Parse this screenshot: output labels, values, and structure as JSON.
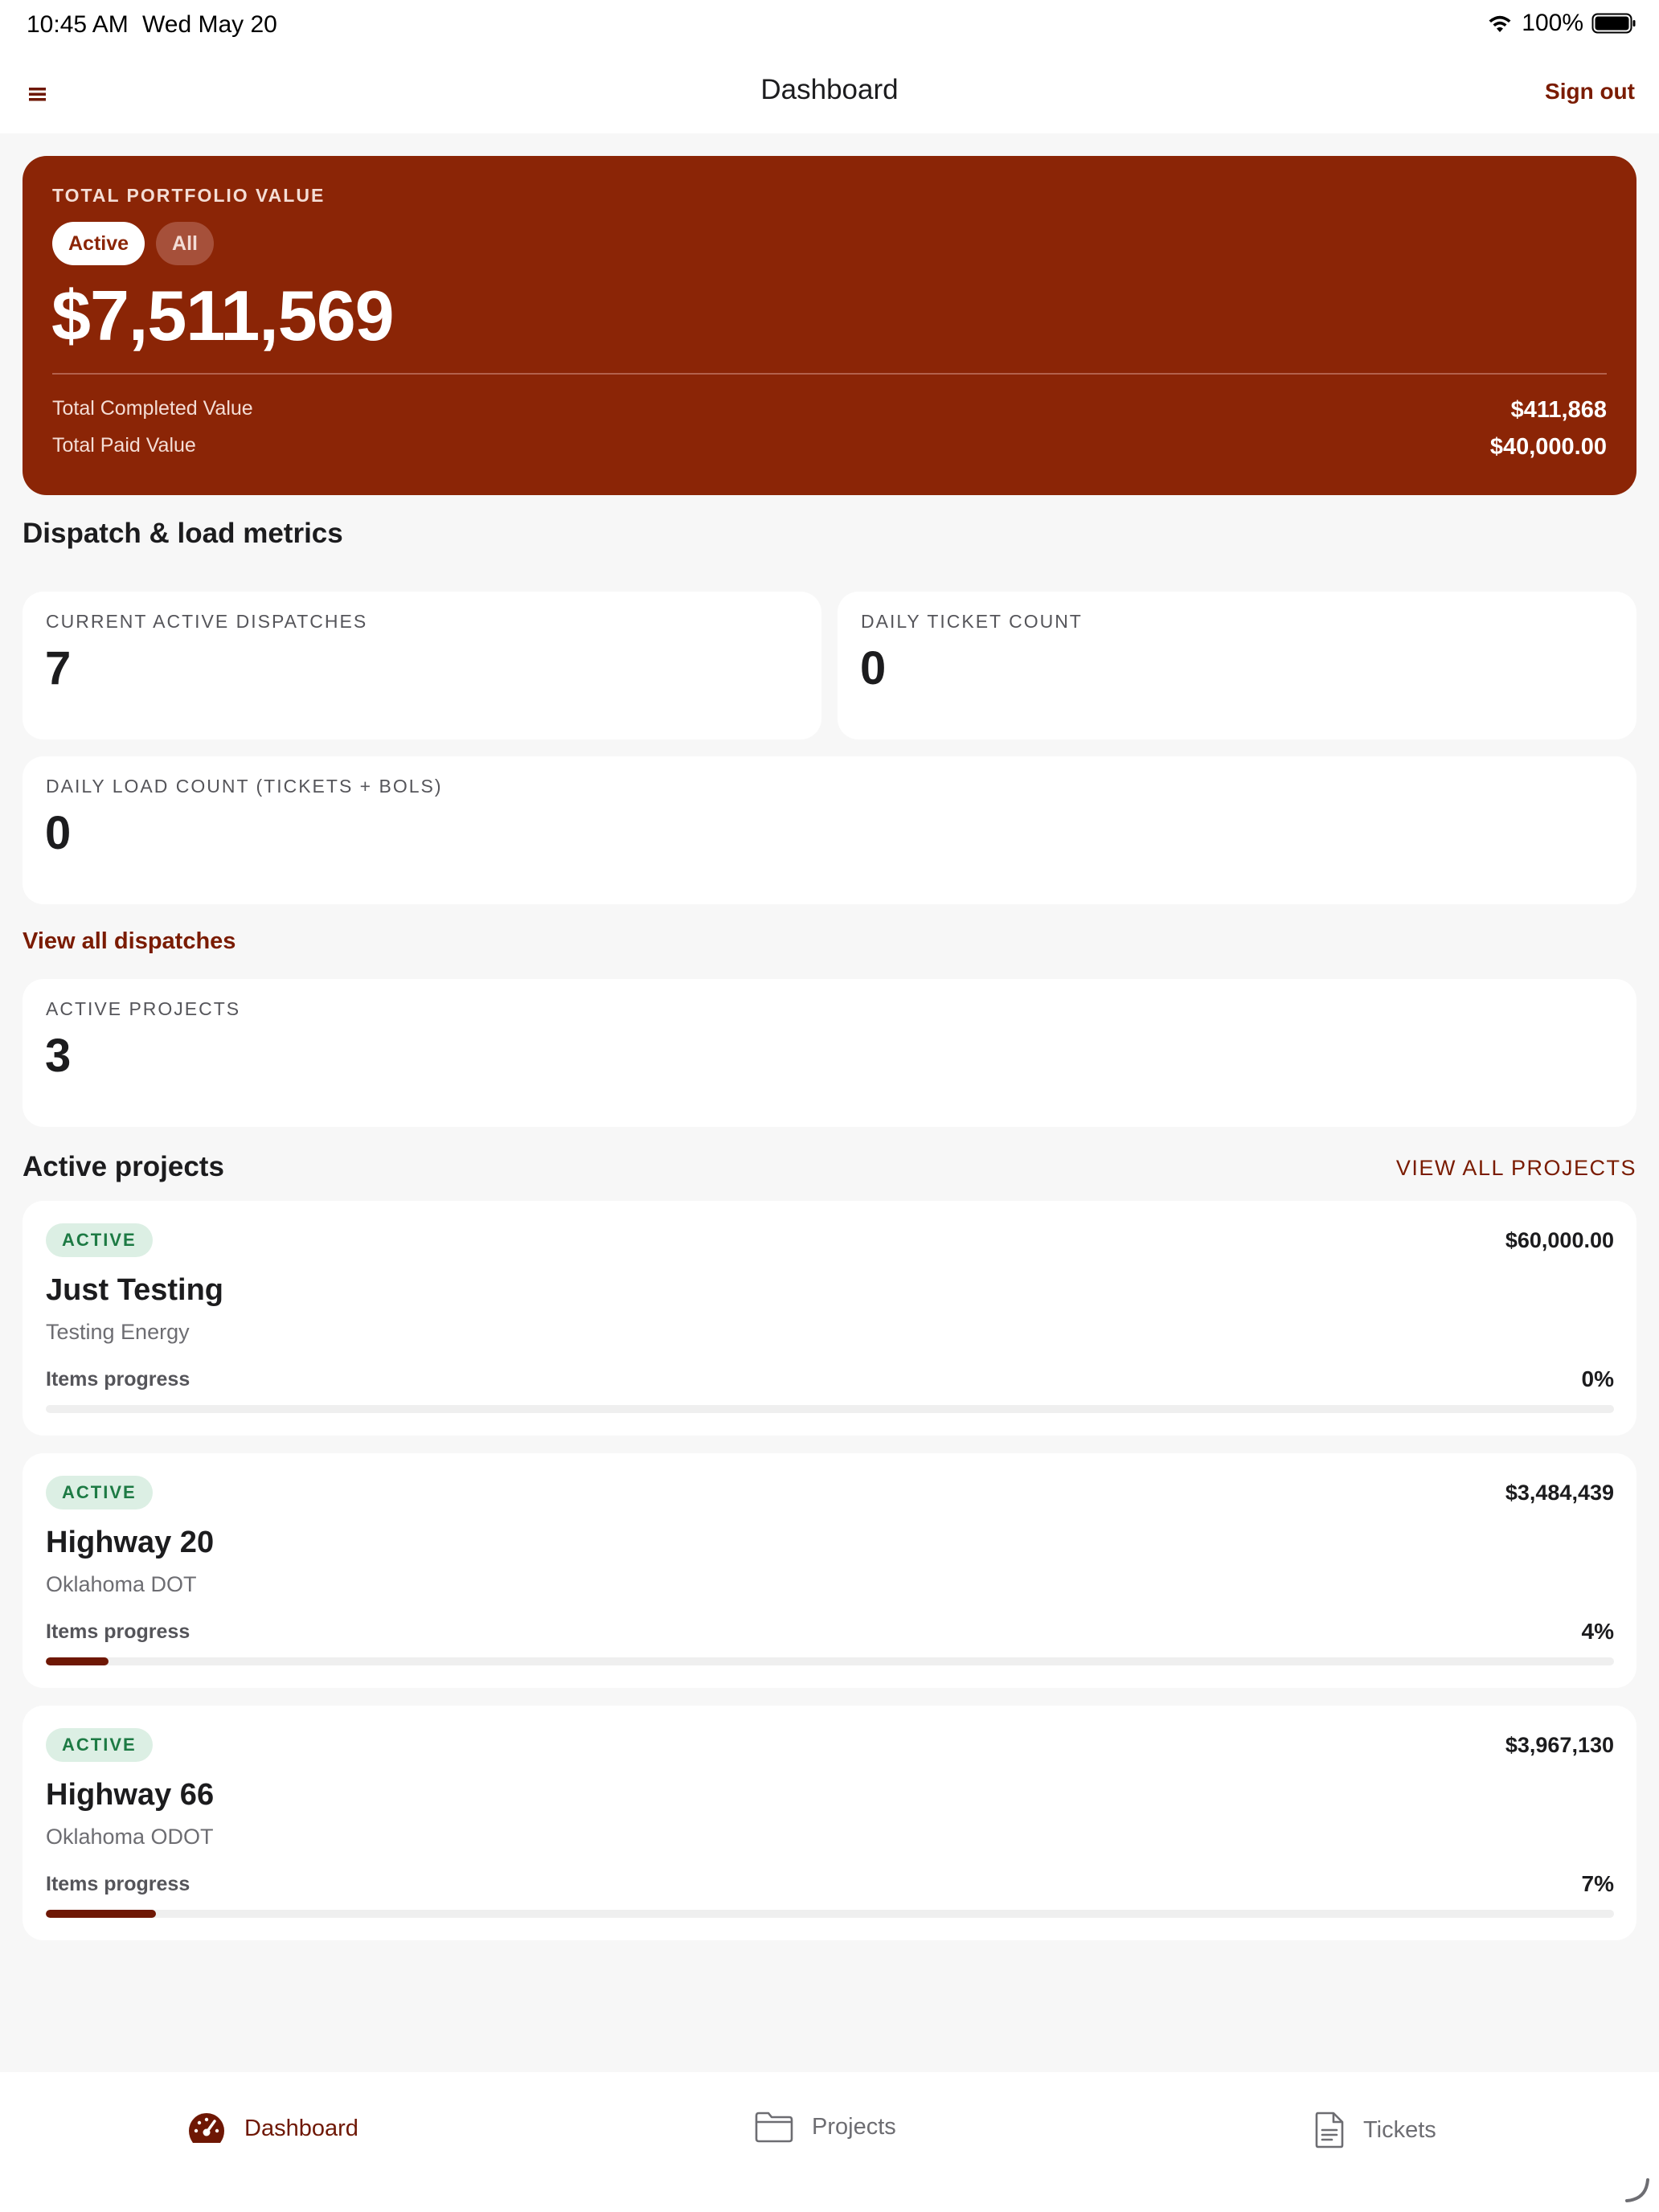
{
  "status_bar": {
    "time": "10:45 AM",
    "date": "Wed May 20",
    "battery": "100%"
  },
  "nav": {
    "title": "Dashboard",
    "sign_out": "Sign out",
    "menu_icon": "hamburger-icon"
  },
  "portfolio": {
    "label": "TOTAL PORTFOLIO VALUE",
    "toggle_active": "Active",
    "toggle_all": "All",
    "value": "$7,511,569",
    "completed_label": "Total Completed Value",
    "completed_value": "$411,868",
    "paid_label": "Total Paid Value",
    "paid_value": "$40,000.00"
  },
  "dispatch": {
    "title": "Dispatch & load metrics",
    "active_dispatches_label": "CURRENT ACTIVE DISPATCHES",
    "active_dispatches_value": "7",
    "daily_ticket_label": "DAILY TICKET COUNT",
    "daily_ticket_value": "0",
    "daily_load_label": "DAILY LOAD COUNT (TICKETS + BOLS)",
    "daily_load_value": "0",
    "view_all": "View all dispatches"
  },
  "active_projects_metric": {
    "label": "ACTIVE PROJECTS",
    "value": "3"
  },
  "projects_section": {
    "title": "Active projects",
    "view_all": "VIEW ALL PROJECTS"
  },
  "projects": [
    {
      "status": "ACTIVE",
      "amount": "$60,000.00",
      "name": "Just Testing",
      "client": "Testing Energy",
      "progress_label": "Items progress",
      "progress_text": "0%",
      "progress": 0
    },
    {
      "status": "ACTIVE",
      "amount": "$3,484,439",
      "name": "Highway 20",
      "client": "Oklahoma DOT",
      "progress_label": "Items progress",
      "progress_text": "4%",
      "progress": 4
    },
    {
      "status": "ACTIVE",
      "amount": "$3,967,130",
      "name": "Highway 66",
      "client": "Oklahoma ODOT",
      "progress_label": "Items progress",
      "progress_text": "7%",
      "progress": 7
    }
  ],
  "tabs": [
    {
      "label": "Dashboard",
      "icon": "speedometer-icon",
      "selected": true
    },
    {
      "label": "Projects",
      "icon": "folder-icon",
      "selected": false
    },
    {
      "label": "Tickets",
      "icon": "document-icon",
      "selected": false
    }
  ],
  "colors": {
    "brand": "#8b2506",
    "accent": "#6e1704",
    "active_badge_bg": "#dcefe4",
    "active_badge_text": "#1d7a44"
  }
}
